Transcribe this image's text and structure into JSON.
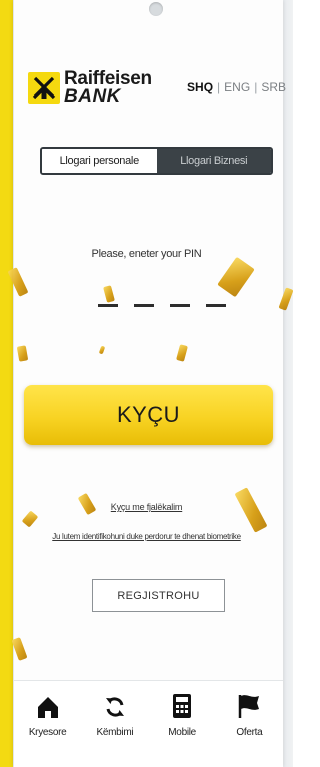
{
  "brand": {
    "line1": "Raiffeisen",
    "line2": "BANK",
    "logo_color": "#f5d90f"
  },
  "languages": {
    "items": [
      "SHQ",
      "ENG",
      "SRB"
    ],
    "selected": "SHQ",
    "separator": "|"
  },
  "account_type": {
    "tabs": [
      {
        "label": "Llogari personale",
        "selected": true
      },
      {
        "label": "Llogari Biznesi",
        "selected": false
      }
    ]
  },
  "pin": {
    "prompt": "Please, eneter your PIN",
    "digits_count": 4
  },
  "login": {
    "label": "KYÇU",
    "color": "#f8d323"
  },
  "links": {
    "forgot": "Kyçu me fjalëkalim",
    "identification": "Ju lutem identifikohuni duke perdorur te dhenat biometrike"
  },
  "register": {
    "label": "REGJISTROHU"
  },
  "bottom_nav": {
    "items": [
      {
        "label": "Kryesore",
        "icon": "home-icon"
      },
      {
        "label": "Këmbimi",
        "icon": "exchange-icon"
      },
      {
        "label": "Mobile",
        "icon": "calculator-icon"
      },
      {
        "label": "Oferta",
        "icon": "flag-icon"
      }
    ]
  }
}
